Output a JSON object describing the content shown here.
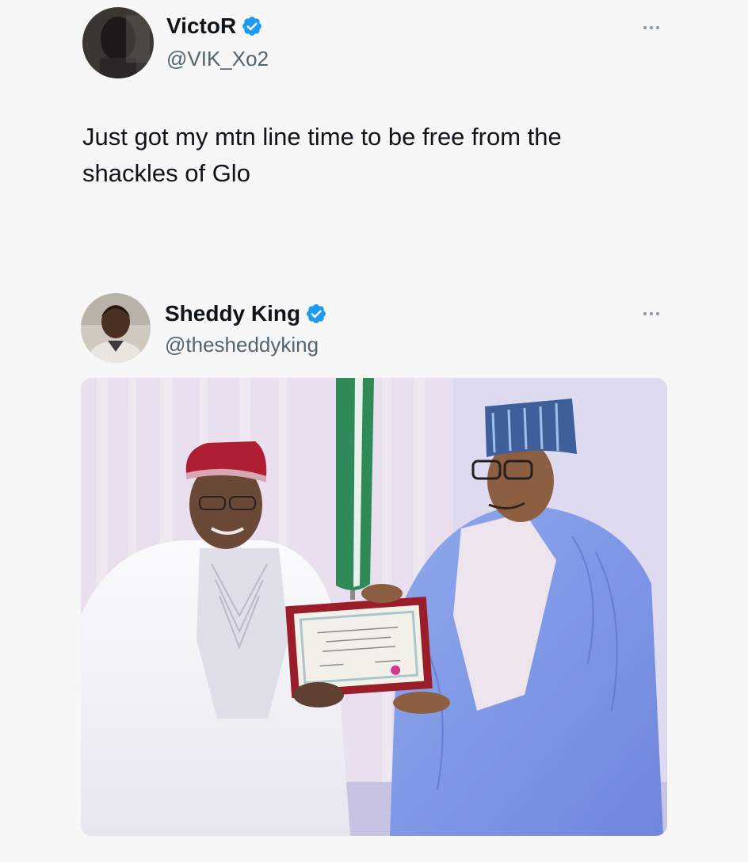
{
  "tweets": [
    {
      "display_name": "VictoR",
      "handle": "@VIK_Xo2",
      "verified": true,
      "text": "Just got my mtn line time to be free from the shackles of Glo",
      "more_icon": "more-horizontal-icon"
    },
    {
      "display_name": "Sheddy King",
      "handle": "@thesheddyking",
      "verified": true,
      "text": "",
      "more_icon": "more-horizontal-icon",
      "media": {
        "type": "photo"
      }
    }
  ],
  "colors": {
    "background": "#f7f7f7",
    "text": "#0f1419",
    "secondary_text": "#536471",
    "verified_badge": "#1d9bf0"
  }
}
